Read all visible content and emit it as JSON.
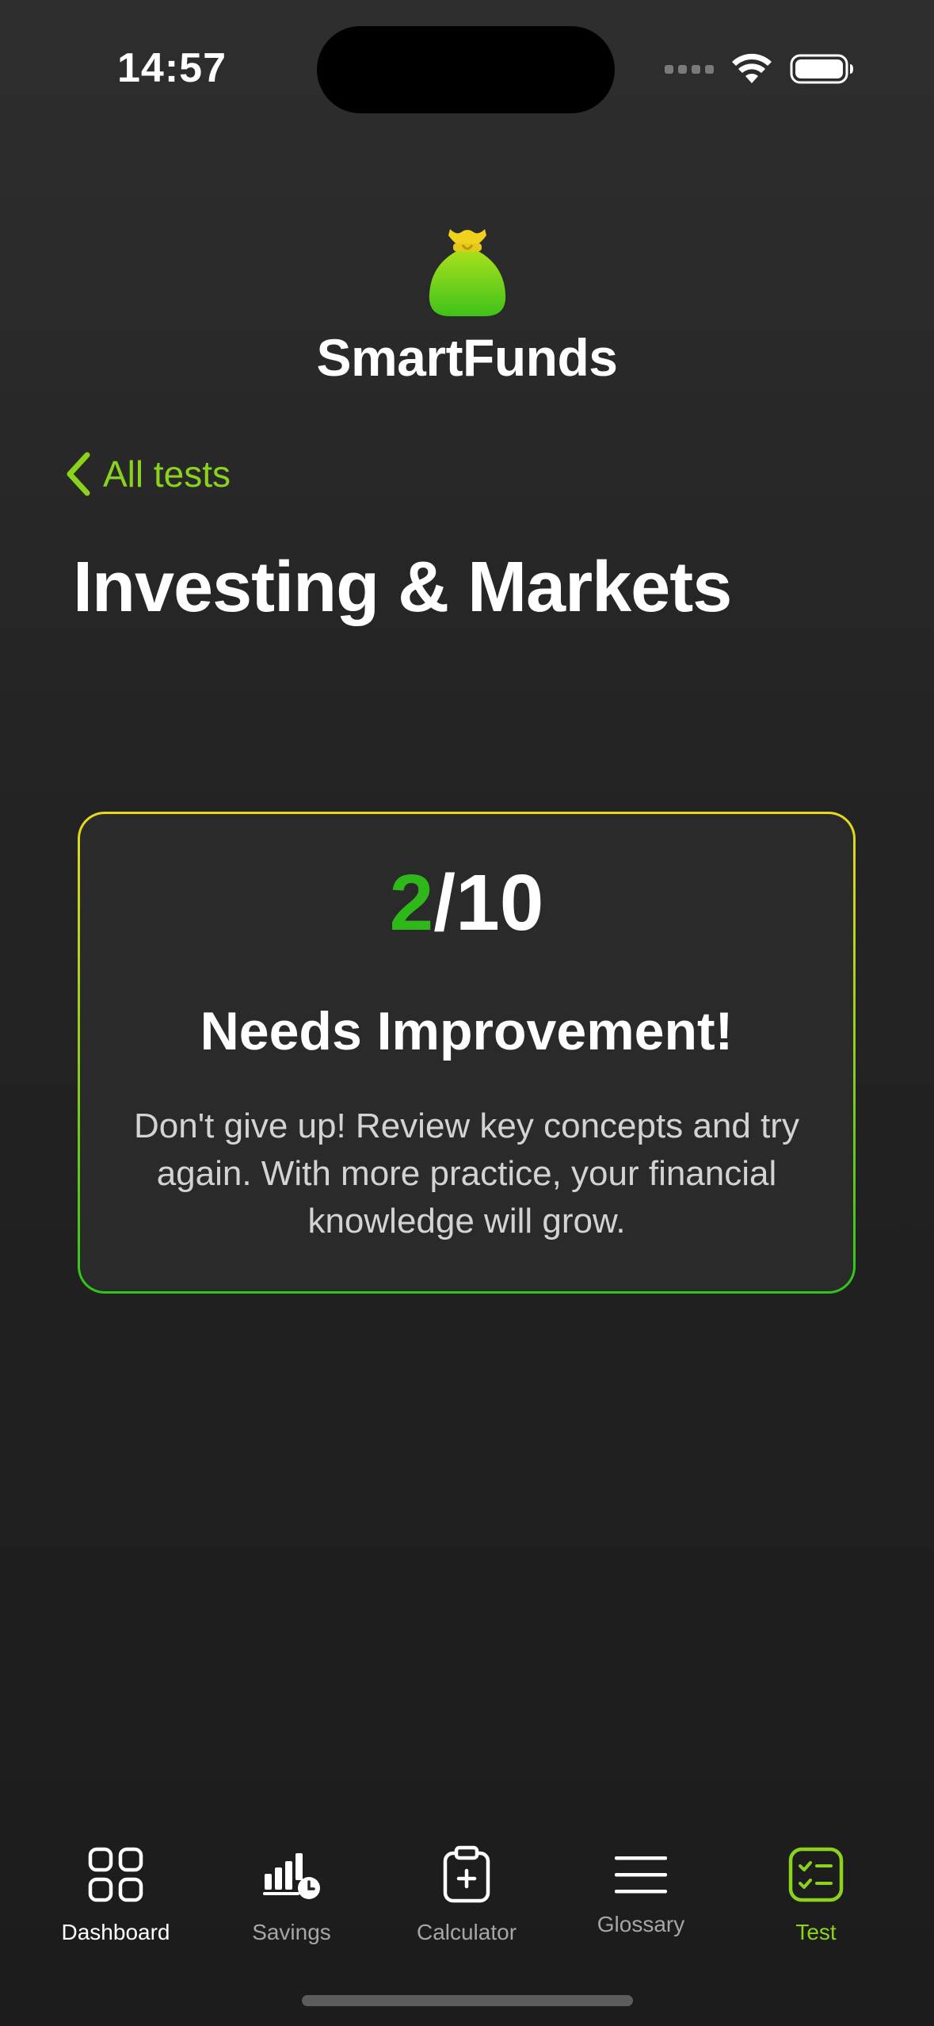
{
  "status_bar": {
    "time": "14:57"
  },
  "app": {
    "name": "SmartFunds",
    "logo_icon": "money-bag-icon",
    "accent_color": "#8bd21c",
    "score_color": "#2fb81a"
  },
  "nav": {
    "back_label": "All tests"
  },
  "page": {
    "title": "Investing & Markets"
  },
  "result": {
    "score": "2",
    "separator": "/",
    "total": "10",
    "heading": "Needs Improvement!",
    "message": "Don't give up! Review key concepts and try again. With more practice, your financial knowledge will grow."
  },
  "tabbar": {
    "items": [
      {
        "label": "Dashboard",
        "icon": "dashboard-grid-icon"
      },
      {
        "label": "Savings",
        "icon": "savings-chart-icon"
      },
      {
        "label": "Calculator",
        "icon": "calculator-clipboard-icon"
      },
      {
        "label": "Glossary",
        "icon": "menu-lines-icon"
      },
      {
        "label": "Test",
        "icon": "test-checklist-icon",
        "selected": true
      }
    ]
  }
}
